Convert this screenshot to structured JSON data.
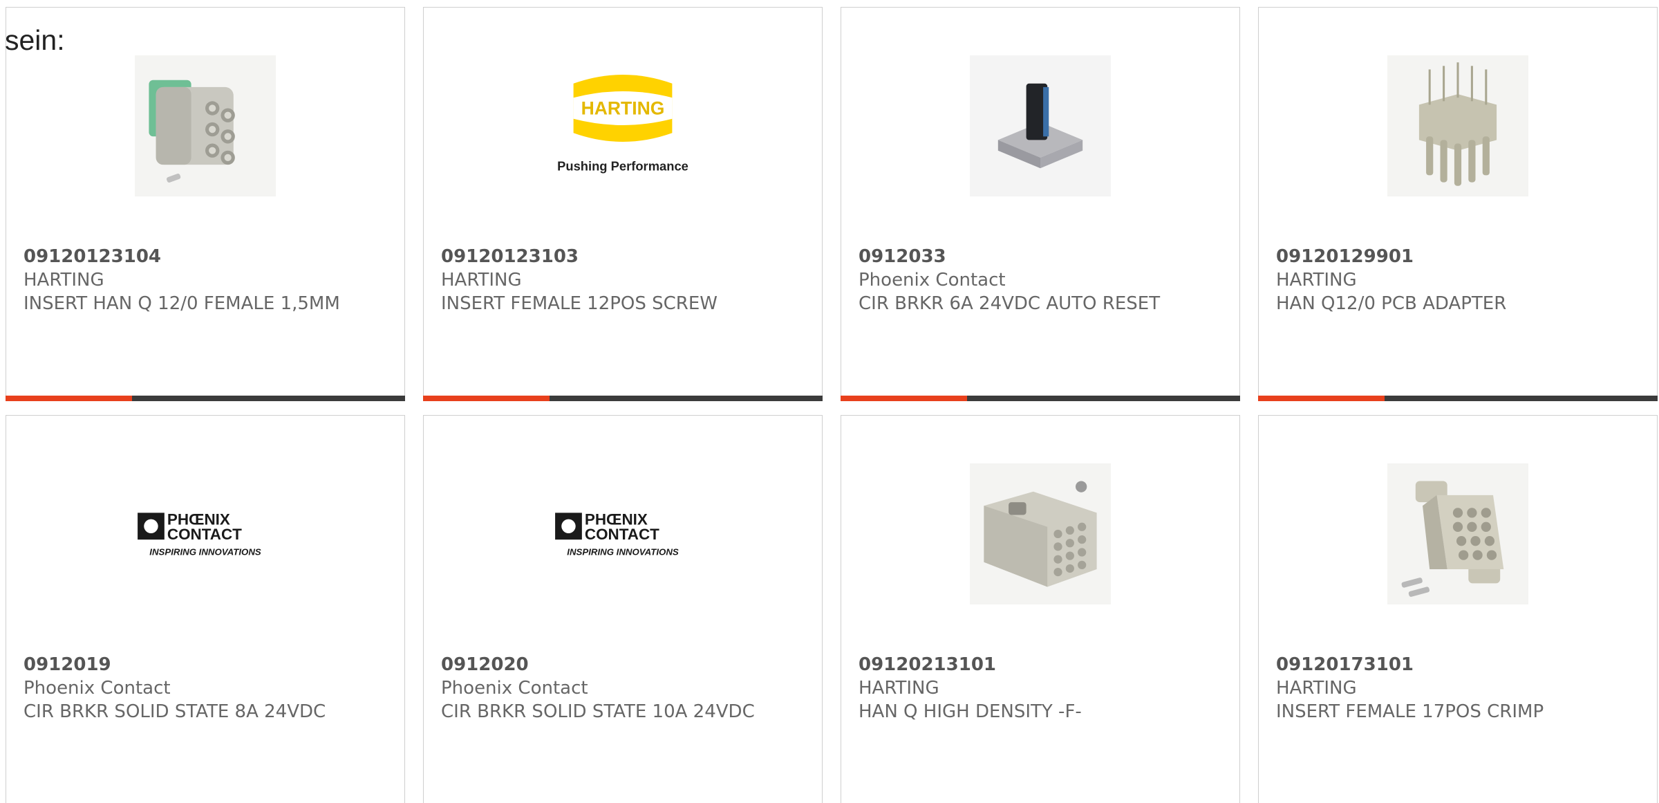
{
  "heading": "sein:",
  "accent_color": "#e8401c",
  "bar_color": "#3b3b3b",
  "products": [
    {
      "part_number": "09120123104",
      "manufacturer": "HARTING",
      "description": "INSERT HAN Q 12/0 FEMALE 1,5MM",
      "image_icon": "connector-insert-icon"
    },
    {
      "part_number": "09120123103",
      "manufacturer": "HARTING",
      "description": "INSERT FEMALE 12POS SCREW",
      "image_icon": "harting-logo",
      "logo_text": "HARTING",
      "logo_tagline": "Pushing Performance"
    },
    {
      "part_number": "0912033",
      "manufacturer": "Phoenix Contact",
      "description": "CIR BRKR 6A 24VDC AUTO RESET",
      "image_icon": "circuit-breaker-icon"
    },
    {
      "part_number": "09120129901",
      "manufacturer": "HARTING",
      "description": "HAN Q12/0 PCB ADAPTER",
      "image_icon": "pcb-adapter-icon"
    },
    {
      "part_number": "0912019",
      "manufacturer": "Phoenix Contact",
      "description": "CIR BRKR SOLID STATE 8A 24VDC",
      "image_icon": "phoenix-contact-logo",
      "logo_text": "PHOENIX CONTACT",
      "logo_tagline": "INSPIRING INNOVATIONS"
    },
    {
      "part_number": "0912020",
      "manufacturer": "Phoenix Contact",
      "description": "CIR BRKR SOLID STATE 10A 24VDC",
      "image_icon": "phoenix-contact-logo",
      "logo_text": "PHOENIX CONTACT",
      "logo_tagline": "INSPIRING INNOVATIONS"
    },
    {
      "part_number": "09120213101",
      "manufacturer": "HARTING",
      "description": "HAN Q HIGH DENSITY -F-",
      "image_icon": "high-density-connector-icon"
    },
    {
      "part_number": "09120173101",
      "manufacturer": "HARTING",
      "description": "INSERT FEMALE 17POS CRIMP",
      "image_icon": "crimp-insert-icon"
    }
  ]
}
